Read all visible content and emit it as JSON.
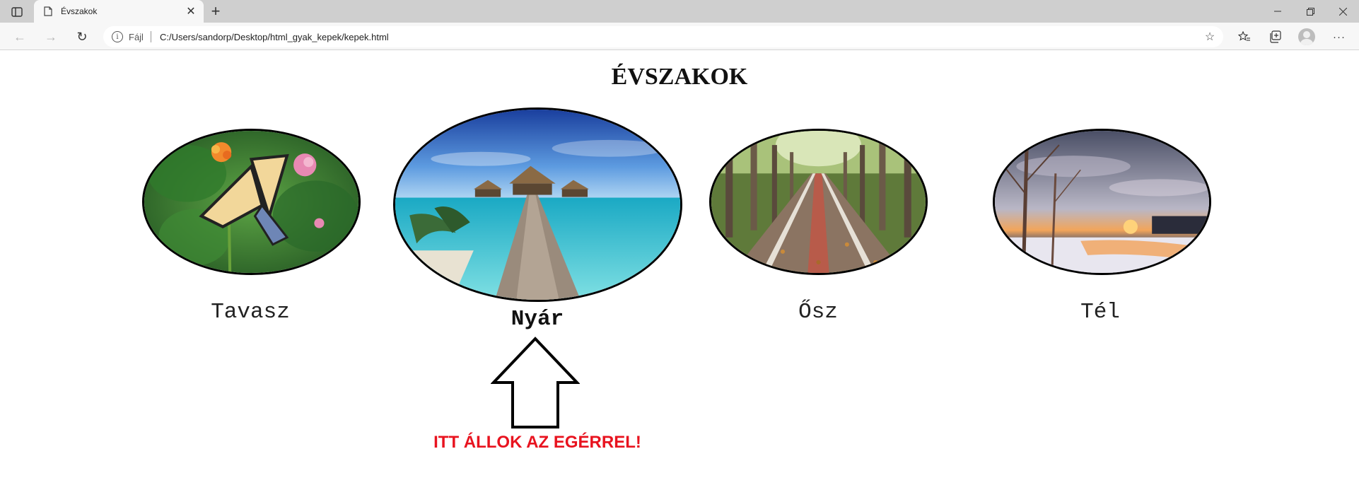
{
  "browser": {
    "tab": {
      "title": "Évszakok",
      "favicon": "page-icon"
    },
    "address": {
      "scheme": "Fájl",
      "url": "C:/Users/sandorp/Desktop/html_gyak_kepek/kepek.html"
    },
    "icons": {
      "tab_actions": "tab-actions-icon",
      "close_tab": "close-icon",
      "new_tab": "plus-icon",
      "back": "back-arrow-icon",
      "forward": "forward-arrow-icon",
      "refresh": "refresh-icon",
      "site_info": "info-icon",
      "add_favorite": "star-plus-icon",
      "favorites": "favorites-icon",
      "collections": "collections-icon",
      "profile": "avatar-icon",
      "menu": "more-icon",
      "minimize": "minimize-icon",
      "restore": "restore-icon",
      "close_window": "close-window-icon"
    }
  },
  "page": {
    "title": "ÉVSZAKOK",
    "seasons": [
      {
        "label": "Tavasz",
        "image": "butterfly-on-flowers",
        "active": false
      },
      {
        "label": "Nyár",
        "image": "beach-pier-bungalows",
        "active": true
      },
      {
        "label": "Ősz",
        "image": "autumn-tree-alley",
        "active": false
      },
      {
        "label": "Tél",
        "image": "winter-sunset-river",
        "active": false
      }
    ],
    "pointer": {
      "icon": "up-arrow-icon",
      "note": "ITT ÁLLOK AZ EGÉRREL!",
      "note_color": "#e8131f"
    }
  }
}
